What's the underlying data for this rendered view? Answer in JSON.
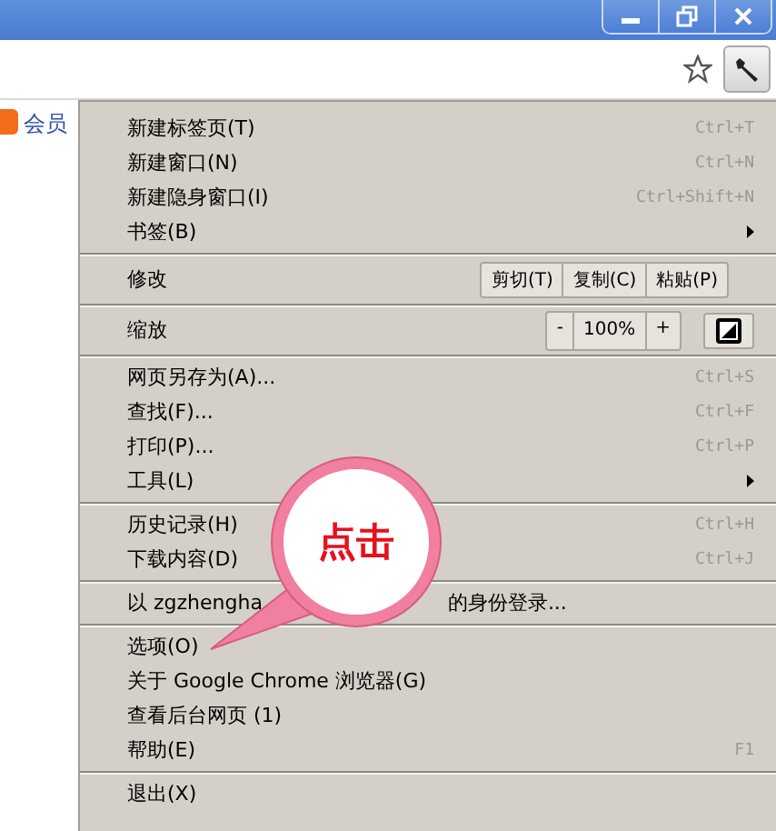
{
  "bookmarks_bar": {
    "items": [
      {
        "label": "会员"
      }
    ]
  },
  "menu": {
    "sections": [
      [
        {
          "kind": "item",
          "label": "新建标签页(T)",
          "shortcut": "Ctrl+T"
        },
        {
          "kind": "item",
          "label": "新建窗口(N)",
          "shortcut": "Ctrl+N"
        },
        {
          "kind": "item",
          "label": "新建隐身窗口(I)",
          "shortcut": "Ctrl+Shift+N"
        },
        {
          "kind": "submenu",
          "label": "书签(B)"
        }
      ],
      [
        {
          "kind": "edit",
          "label": "修改",
          "buttons": [
            "剪切(T)",
            "复制(C)",
            "粘贴(P)"
          ]
        }
      ],
      [
        {
          "kind": "zoom",
          "label": "缩放",
          "minus": "-",
          "value": "100%",
          "plus": "+"
        }
      ],
      [
        {
          "kind": "item",
          "label": "网页另存为(A)...",
          "shortcut": "Ctrl+S"
        },
        {
          "kind": "item",
          "label": "查找(F)...",
          "shortcut": "Ctrl+F"
        },
        {
          "kind": "item",
          "label": "打印(P)...",
          "shortcut": "Ctrl+P"
        },
        {
          "kind": "submenu",
          "label": "工具(L)"
        }
      ],
      [
        {
          "kind": "item",
          "label": "历史记录(H)",
          "shortcut": "Ctrl+H"
        },
        {
          "kind": "item",
          "label": "下载内容(D)",
          "shortcut": "Ctrl+J"
        }
      ],
      [
        {
          "kind": "signin",
          "prefix": "以 zgzhengha",
          "suffix": "的身份登录..."
        }
      ],
      [
        {
          "kind": "item",
          "label": "选项(O)"
        },
        {
          "kind": "item",
          "label": "关于 Google Chrome 浏览器(G)"
        },
        {
          "kind": "item",
          "label": "查看后台网页 (1)"
        },
        {
          "kind": "item",
          "label": "帮助(E)",
          "shortcut": "F1"
        }
      ],
      [
        {
          "kind": "item",
          "label": "退出(X)"
        }
      ]
    ]
  },
  "callout": {
    "text": "点击"
  }
}
